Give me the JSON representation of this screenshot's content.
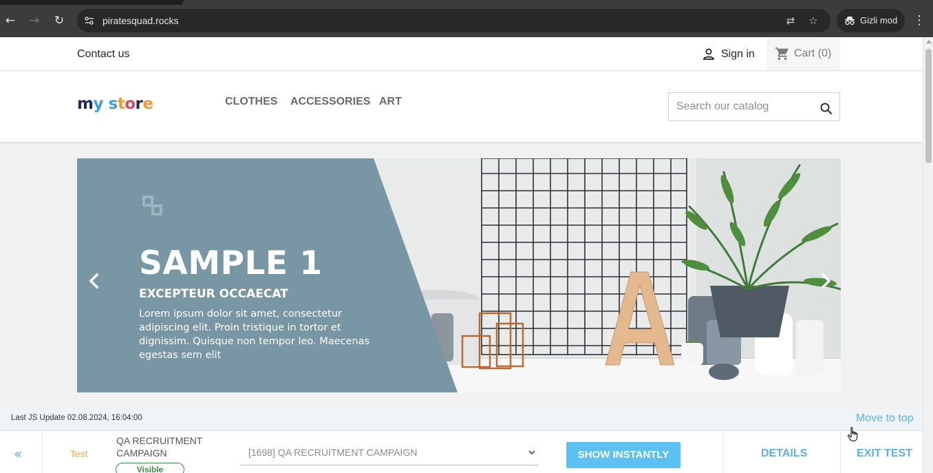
{
  "browser": {
    "url": "piratesquad.rocks",
    "incognito_label": "Gizli mod"
  },
  "store": {
    "contact_label": "Contact us",
    "signin_label": "Sign in",
    "cart_label": "Cart (0)",
    "logo": [
      "m",
      "y",
      " ",
      "s",
      "t",
      "o",
      "r",
      "e"
    ],
    "logo_colors": [
      "#1f2a5a",
      "#3aa0d8",
      "#ffffff",
      "#3aa0d8",
      "#f39c34",
      "#e8455a",
      "#1f2a5a",
      "#f39c34"
    ],
    "menu": [
      "CLOTHES",
      "ACCESSORIES",
      "ART"
    ],
    "search_placeholder": "Search our catalog"
  },
  "slider": {
    "title": "SAMPLE 1",
    "subtitle": "EXCEPTEUR OCCAECAT",
    "body": "Lorem ipsum dolor sit amet, consectetur adipiscing elit. Proin tristique in tortor et dignissim. Quisque non tempor leo. Maecenas egestas sem elit",
    "panel_color": "#7896a3"
  },
  "debug": {
    "last_js_update": "Last JS Update 02.08.2024, 16:04:00",
    "move_to_top": "Move to top",
    "collapse_icon": "«",
    "test_label": "Test",
    "campaign_name": "QA RECRUITMENT CAMPAIGN",
    "visibility_badge": "Visible",
    "campaign_select_value": "[1698] QA RECRUITMENT CAMPAIGN",
    "show_button": "SHOW INSTANTLY",
    "details_button": "DETAILS",
    "exit_button": "EXIT TEST",
    "accent": "#5ab2e6"
  }
}
